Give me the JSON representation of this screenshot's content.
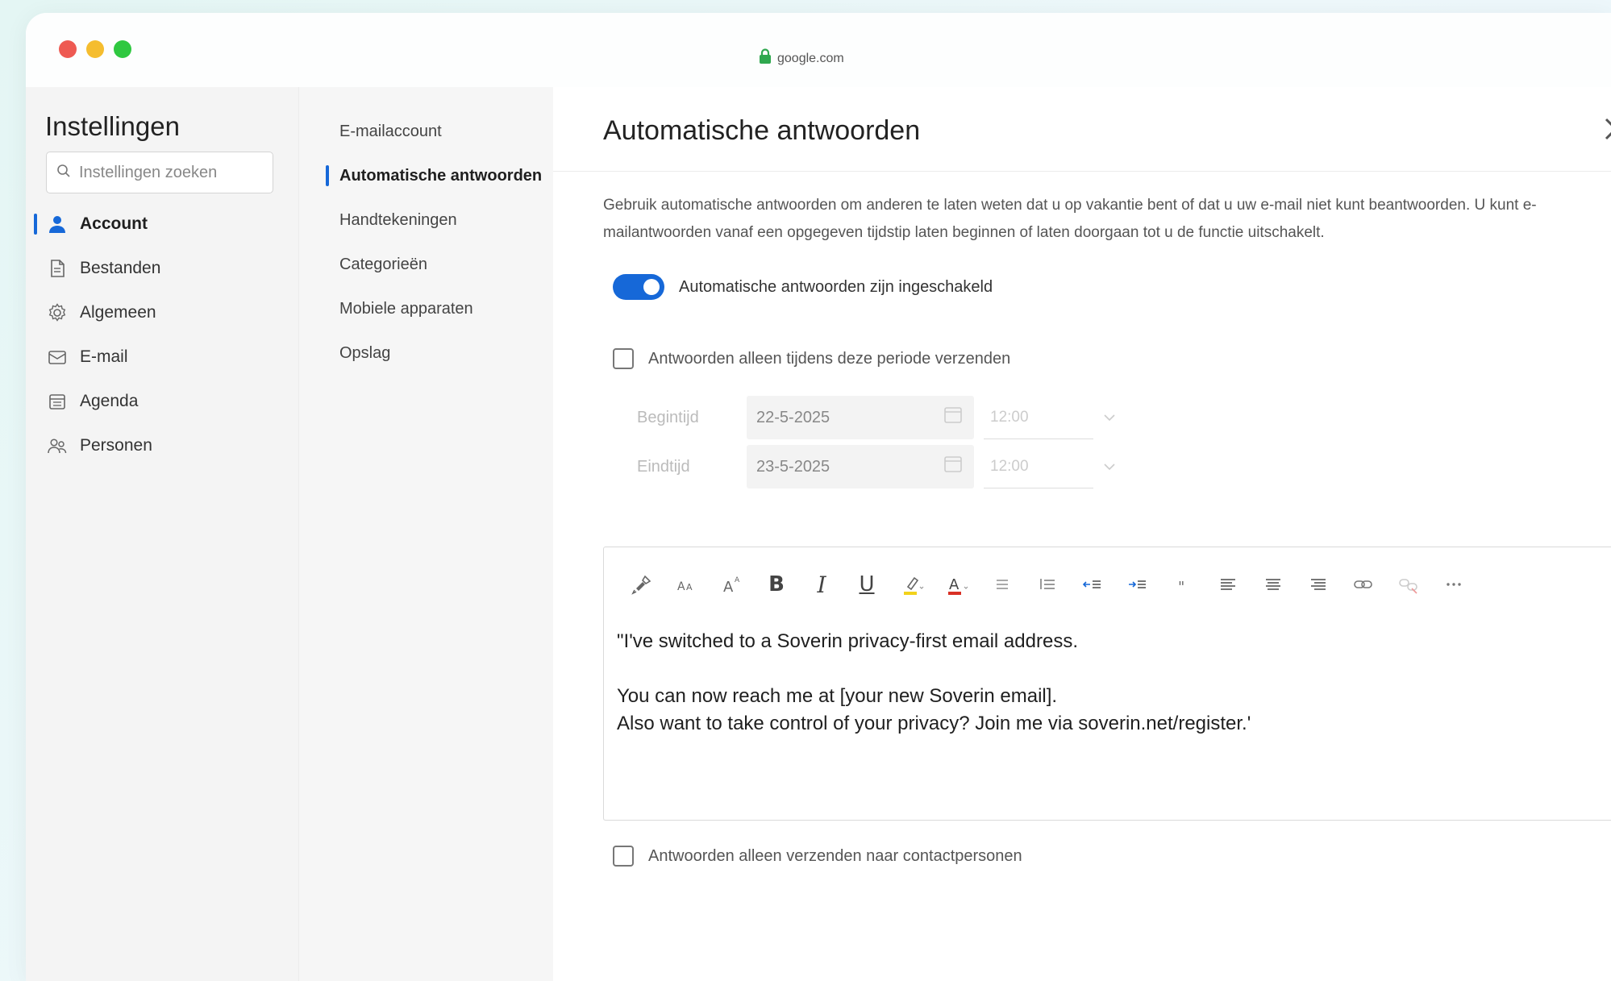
{
  "browser": {
    "url": "google.com"
  },
  "sidebar": {
    "title": "Instellingen",
    "search_placeholder": "Instellingen zoeken",
    "items": [
      {
        "label": "Account",
        "icon": "person-icon",
        "active": true
      },
      {
        "label": "Bestanden",
        "icon": "file-icon",
        "active": false
      },
      {
        "label": "Algemeen",
        "icon": "gear-icon",
        "active": false
      },
      {
        "label": "E-mail",
        "icon": "mail-icon",
        "active": false
      },
      {
        "label": "Agenda",
        "icon": "calendar-icon",
        "active": false
      },
      {
        "label": "Personen",
        "icon": "people-icon",
        "active": false
      }
    ]
  },
  "subnav": {
    "items": [
      {
        "label": "E-mailaccount",
        "active": false
      },
      {
        "label": "Automatische antwoorden",
        "active": true
      },
      {
        "label": "Handtekeningen",
        "active": false
      },
      {
        "label": "Categorieën",
        "active": false
      },
      {
        "label": "Mobiele apparaten",
        "active": false
      },
      {
        "label": "Opslag",
        "active": false
      }
    ]
  },
  "main": {
    "title": "Automatische antwoorden",
    "description": "Gebruik automatische antwoorden om anderen te laten weten dat u op vakantie bent of dat u uw e-mail niet kunt beantwoorden. U kunt e-mailantwoorden vanaf een opgegeven tijdstip laten beginnen of laten doorgaan tot u de functie uitschakelt.",
    "toggle_label": "Automatische antwoorden zijn ingeschakeld",
    "toggle_on": true,
    "period_checkbox_label": "Antwoorden alleen tijdens deze periode verzenden",
    "start_label": "Begintijd",
    "start_date": "22-5-2025",
    "start_time": "12:00",
    "end_label": "Eindtijd",
    "end_date": "23-5-2025",
    "end_time": "12:00",
    "message_lines": [
      "\"I've switched to a Soverin privacy-first email address.",
      "",
      "You can now reach me at [your new Soverin email].",
      "Also want to take control of your privacy? Join me via soverin.net/register.'"
    ],
    "contacts_checkbox_label": "Antwoorden alleen verzenden naar contactpersonen"
  },
  "colors": {
    "accent": "#1668d8",
    "highlight": "#f2d21b",
    "font_color": "#d93025"
  }
}
